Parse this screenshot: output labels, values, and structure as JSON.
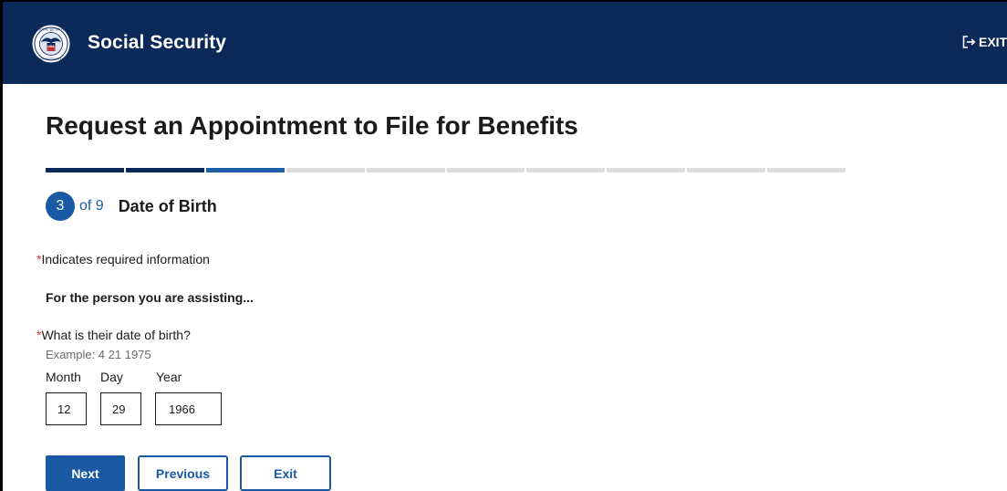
{
  "header": {
    "brand": "Social Security",
    "exit_label": "EXIT",
    "logo_text": "SOCIAL SECURITY ADMINISTRATION USA",
    "background": "#0b2a5a"
  },
  "page": {
    "title": "Request an Appointment to File for Benefits"
  },
  "progress": {
    "total_steps": 9,
    "current_step": 3
  },
  "step": {
    "number": "3",
    "of_text": "of 9",
    "title": "Date of Birth"
  },
  "form": {
    "required_asterisk": "*",
    "required_note": "Indicates required information",
    "section_label": "For the person you are assisting...",
    "question": "What is their date of birth?",
    "example": "Example: 4 21 1975",
    "month_label": "Month",
    "day_label": "Day",
    "year_label": "Year",
    "month_value": "12",
    "day_value": "29",
    "year_value": "1966"
  },
  "buttons": {
    "next": "Next",
    "previous": "Previous",
    "exit": "Exit"
  },
  "colors": {
    "primary": "#1a5aa5",
    "navy": "#0b2a5a",
    "required": "#d83933"
  }
}
